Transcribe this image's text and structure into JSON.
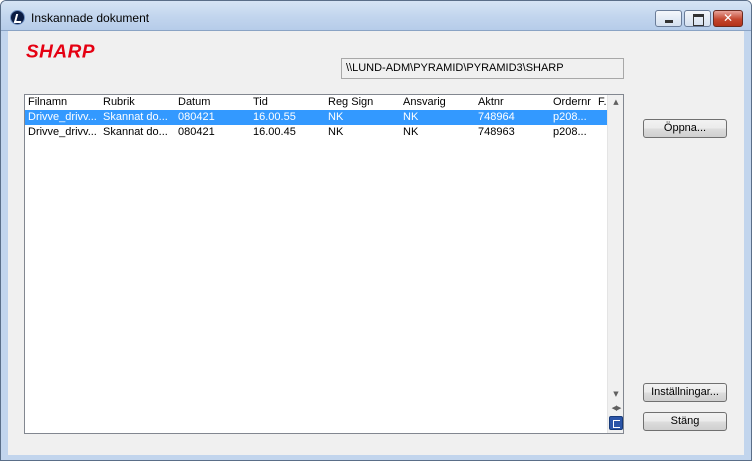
{
  "window": {
    "title": "Inskannade dokument"
  },
  "logo": {
    "text": "SHARP",
    "color": "#e50012"
  },
  "path": {
    "value": "\\\\LUND-ADM\\PYRAMID\\PYRAMID3\\SHARP"
  },
  "list": {
    "columns": [
      "Filnamn",
      "Rubrik",
      "Datum",
      "Tid",
      "Reg Sign",
      "Ansvarig",
      "Aktnr",
      "Ordernr",
      "F..."
    ],
    "rows": [
      {
        "selected": true,
        "cells": [
          "Drivve_drivv...",
          "Skannat do...",
          "080421",
          "16.00.55",
          "NK",
          "NK",
          "748964",
          "p208..."
        ]
      },
      {
        "selected": false,
        "cells": [
          "Drivve_drivv...",
          "Skannat do...",
          "080421",
          "16.00.45",
          "NK",
          "NK",
          "748963",
          "p208..."
        ]
      }
    ]
  },
  "buttons": {
    "open": "Öppna...",
    "settings": "Inställningar...",
    "close": "Stäng"
  },
  "colors": {
    "selection": "#3399ff",
    "window_frame": "#c2d5ed"
  }
}
